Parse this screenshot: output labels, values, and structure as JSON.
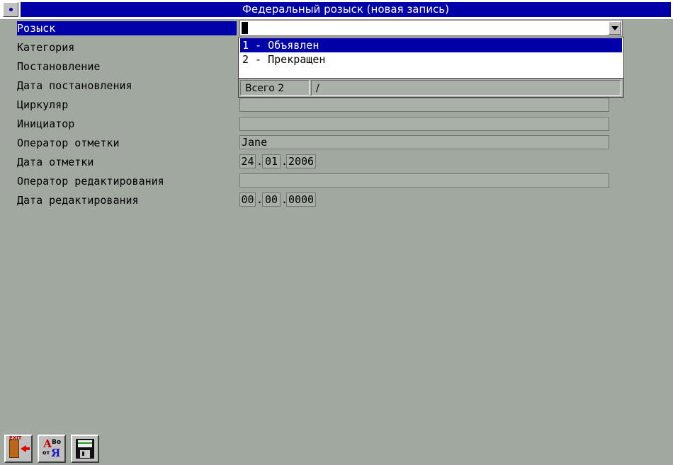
{
  "window": {
    "title": "Федеральный розыск (новая запись)"
  },
  "form": {
    "fields": [
      {
        "label": "Розыск",
        "value": "",
        "active": true
      },
      {
        "label": "Категория",
        "value": ""
      },
      {
        "label": "Постановление",
        "value": ""
      },
      {
        "label": "Дата постановления",
        "value": ""
      },
      {
        "label": "Циркуляр",
        "value": ""
      },
      {
        "label": "Инициатор",
        "value": ""
      },
      {
        "label": "Оператор отметки",
        "value": "Jane"
      },
      {
        "label": "Дата отметки",
        "date": [
          "24",
          "01",
          "2006"
        ]
      },
      {
        "label": "Оператор редактирования",
        "value": ""
      },
      {
        "label": "Дата редактирования",
        "date": [
          "00",
          "00",
          "0000"
        ]
      }
    ]
  },
  "dropdown": {
    "options": [
      "1 - Объявлен",
      "2 - Прекращен"
    ],
    "selected_index": 0,
    "status_total": "Всего 2",
    "status_extra": "/"
  },
  "toolbar": {
    "exit_icon_text": "EXIT",
    "sort_icon_a": "А",
    "sort_icon_vo": "Во",
    "sort_icon_ot": "от",
    "sort_icon_ya": "Я"
  },
  "colors": {
    "background": "#a0a8a0",
    "titlebar": "#0000a8",
    "selection": "#0000a8"
  }
}
